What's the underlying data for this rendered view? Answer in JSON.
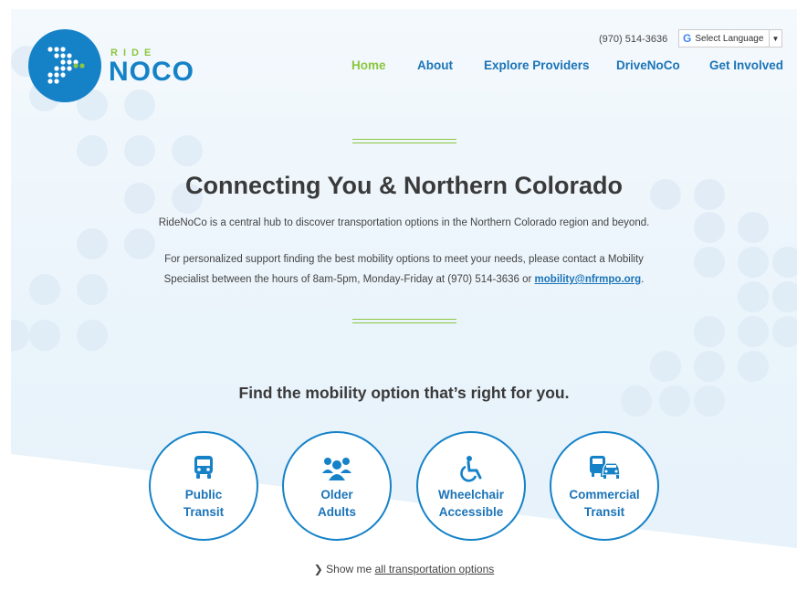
{
  "header": {
    "logo": {
      "ride": "RIDE",
      "noco": "NOCO"
    },
    "phone": "(970) 514-3636",
    "language": {
      "label": "Select Language",
      "arrow": "▼"
    }
  },
  "nav": [
    {
      "label": "Home",
      "active": true
    },
    {
      "label": "About"
    },
    {
      "label": "Explore Providers"
    },
    {
      "label": "DriveNoCo"
    },
    {
      "label": "Get Involved"
    }
  ],
  "hero": {
    "title": "Connecting You & Northern Colorado",
    "intro": "RideNoCo is a central hub to discover transportation options in the Northern Colorado region and beyond.",
    "contact_line1": "For personalized support finding the best mobility options to meet your needs, please contact a Mobility",
    "contact_line2_pre": "Specialist between the hours of 8am-5pm, Monday-Friday at (970) 514-3636 or ",
    "contact_email": "mobility@nfrmpo.org",
    "contact_line2_post": "."
  },
  "options": {
    "title": "Find the mobility option that’s right for you.",
    "items": [
      {
        "line1": "Public",
        "line2": "Transit",
        "icon": "bus-icon"
      },
      {
        "line1": "Older",
        "line2": "Adults",
        "icon": "people-icon"
      },
      {
        "line1": "Wheelchair",
        "line2": "Accessible",
        "icon": "wheelchair-icon"
      },
      {
        "line1": "Commercial",
        "line2": "Transit",
        "icon": "bus-car-icon"
      }
    ],
    "show_me_prefix": "Show me ",
    "show_me_link": "all transportation options"
  },
  "colors": {
    "brand_blue": "#1582c8",
    "brand_green": "#8cc63f",
    "nav_blue": "#1b74b8"
  }
}
